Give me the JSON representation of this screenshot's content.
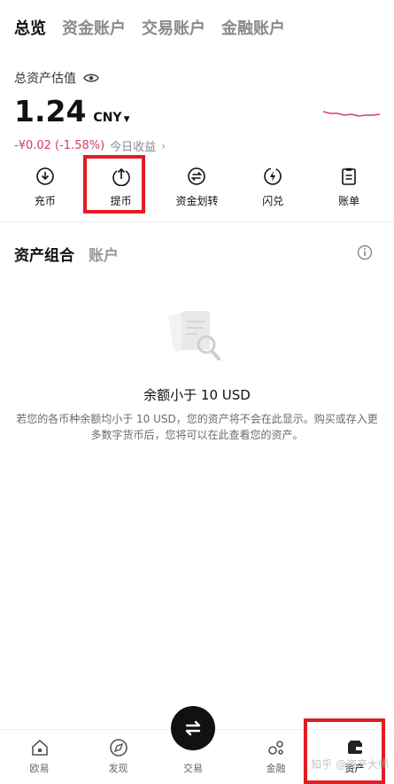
{
  "top_tabs": [
    "总览",
    "资金账户",
    "交易账户",
    "金融账户"
  ],
  "summary": {
    "label": "总资产估值",
    "amount": "1.24",
    "currency": "CNY",
    "pnl_value": "-¥0.02 (-1.58%)",
    "pnl_label": "今日收益",
    "accent_loss": "#d0405a"
  },
  "actions": [
    {
      "label": "充币",
      "icon": "deposit-icon"
    },
    {
      "label": "提币",
      "icon": "withdraw-icon"
    },
    {
      "label": "资金划转",
      "icon": "transfer-icon"
    },
    {
      "label": "闪兑",
      "icon": "flash-swap-icon"
    },
    {
      "label": "账单",
      "icon": "bill-icon"
    }
  ],
  "portfolio": {
    "tabs": [
      "资产组合",
      "账户"
    ],
    "empty_title": "余额小于 10 USD",
    "empty_desc": "若您的各币种余额均小于 10 USD，您的资产将不会在此显示。购买或存入更多数字货币后，您将可以在此查看您的资产。"
  },
  "bottom_nav": [
    {
      "label": "欧易",
      "icon": "home-icon"
    },
    {
      "label": "发现",
      "icon": "discover-icon"
    },
    {
      "label": "交易",
      "icon": "trade-icon"
    },
    {
      "label": "金融",
      "icon": "finance-icon"
    },
    {
      "label": "资产",
      "icon": "wallet-icon"
    }
  ],
  "watermark": "知乎 @资产大师",
  "highlight_color": "#e21c25"
}
